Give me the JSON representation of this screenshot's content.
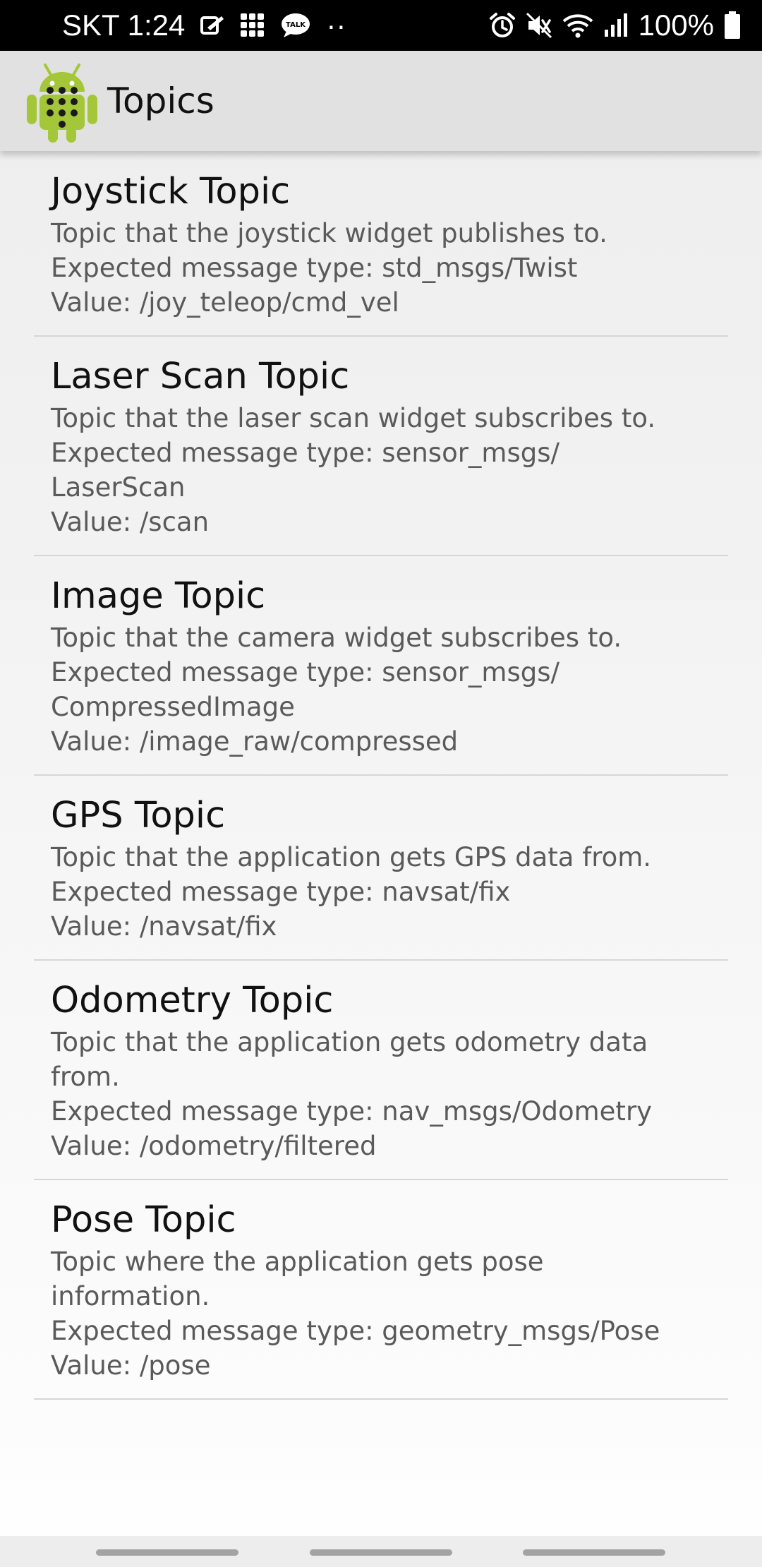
{
  "status_bar": {
    "carrier_time": "SKT 1:24",
    "talk_badge": "TALK",
    "overflow_dots": "··",
    "battery": "100%",
    "icons": [
      "pen-notification-icon",
      "grid-notification-icon",
      "talk-bubble-icon",
      "alarm-icon",
      "mute-icon",
      "wifi-icon",
      "signal-icon",
      "battery-icon"
    ]
  },
  "app_bar": {
    "title": "Topics",
    "icon": "android-robot-icon",
    "icon_color": "#a4c639"
  },
  "preferences": [
    {
      "title": "Joystick Topic",
      "summary": "Topic that the joystick widget publishes to.\nExpected message type: std_msgs/Twist\nValue: /joy_teleop/cmd_vel"
    },
    {
      "title": "Laser Scan Topic",
      "summary": "Topic that the laser scan widget subscribes to.\nExpected message type: sensor_msgs/\nLaserScan\nValue: /scan"
    },
    {
      "title": "Image Topic",
      "summary": "Topic that the camera widget subscribes to.\nExpected message type: sensor_msgs/\nCompressedImage\nValue: /image_raw/compressed"
    },
    {
      "title": "GPS Topic",
      "summary": "Topic that the application gets GPS data from.\nExpected message type: navsat/fix\nValue: /navsat/fix"
    },
    {
      "title": "Odometry Topic",
      "summary": "Topic that the application gets odometry data\nfrom.\nExpected message type: nav_msgs/Odometry\nValue: /odometry/filtered"
    },
    {
      "title": "Pose Topic",
      "summary": "Topic where the application gets pose\ninformation.\nExpected message type: geometry_msgs/Pose\nValue: /pose"
    }
  ],
  "nav_bar": {
    "buttons": [
      "recents-button",
      "home-button",
      "back-button"
    ]
  }
}
